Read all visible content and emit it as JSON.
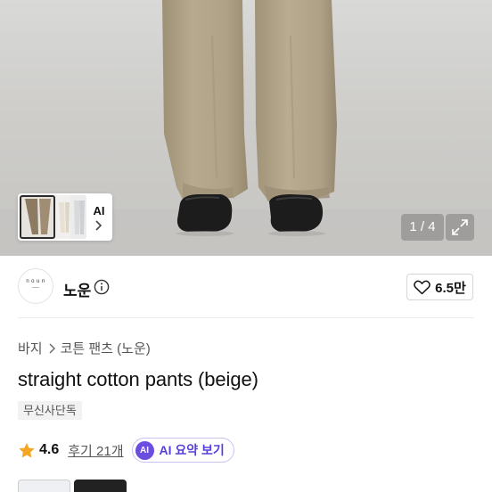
{
  "gallery": {
    "counter": "1 / 4",
    "thumbnail_ai_label": "AI",
    "icons": {
      "thumbnail_next": "chevron-right-icon",
      "expand": "expand-icon"
    }
  },
  "store": {
    "logo_text": "noun",
    "name": "노운",
    "like_count": "6.5만",
    "icons": {
      "info": "info-icon",
      "like": "heart-icon"
    }
  },
  "breadcrumb": {
    "category": "바지",
    "subcategory": "코튼 팬츠 (노운)"
  },
  "product": {
    "title": "straight cotton pants (beige)",
    "badge": "무신사단독",
    "rating": "4.6",
    "reviews": "후기 21개",
    "ai_badge": "AI",
    "ai_summary": "AI 요약 보기"
  },
  "colors": {
    "pants": "#b3a68b",
    "ai_purple": "#6b4ee0",
    "star": "#f5a623"
  }
}
